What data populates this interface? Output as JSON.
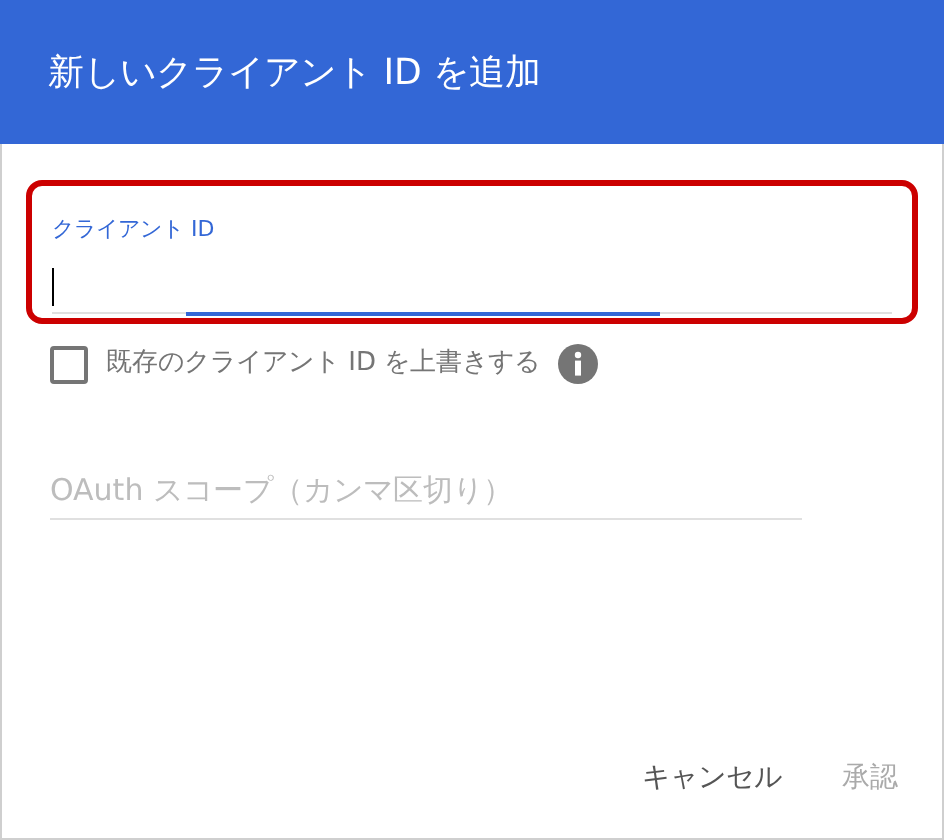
{
  "dialog": {
    "title": "新しいクライアント ID を追加"
  },
  "client_id_field": {
    "label": "クライアント ID",
    "focused": true,
    "highlighted": true
  },
  "overwrite_checkbox": {
    "label": "既存のクライアント ID を上書きする",
    "checked": false
  },
  "scope_field": {
    "placeholder": "OAuth スコープ（カンマ区切り）"
  },
  "buttons": [
    {
      "label": "キャンセル",
      "disabled": false
    },
    {
      "label": "承認",
      "disabled": true
    }
  ]
}
